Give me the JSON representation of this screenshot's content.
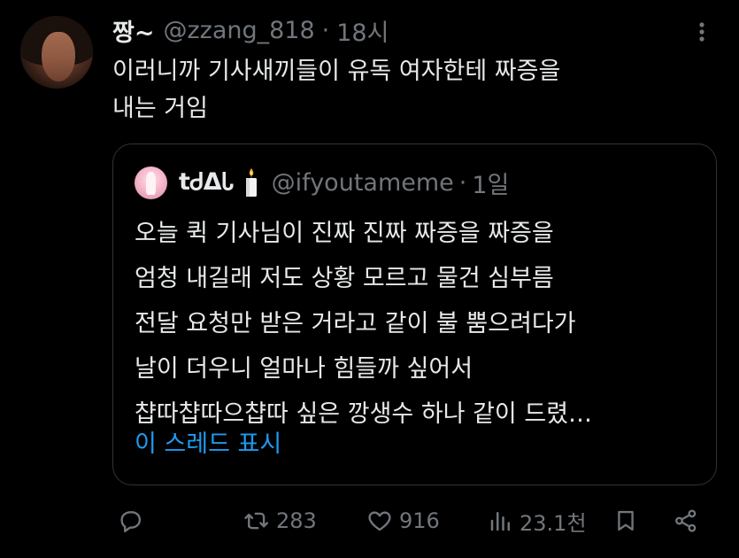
{
  "tweet": {
    "display_name": "짱~",
    "handle": "@zzang_818",
    "separator": "·",
    "time": "18시",
    "text": "이러니까 기사새끼들이 유독 여자한테 짜증을\n내는 거임"
  },
  "quoted_tweet": {
    "display_name": "tᏧᐃᏓ",
    "handle": "@ifyoutameme",
    "separator": "·",
    "time": "1일",
    "text": "오늘 퀵 기사님이 진짜 진짜 짜증을 짜증을\n엄청 내길래 저도 상황 모르고 물건 심부름\n전달 요청만 받은 거라고 같이 불 뿜으려다가\n날이 더우니 얼마나 힘들까 싶어서\n챱따챱따으챱따 싶은 깡생수 하나 같이 드렸…",
    "show_thread_label": "이 스레드 표시"
  },
  "actions": {
    "reply_icon": "reply-icon",
    "retweet_icon": "retweet-icon",
    "retweet_count": "283",
    "like_icon": "heart-icon",
    "like_count": "916",
    "views_icon": "views-icon",
    "views_count": "23.1천",
    "bookmark_icon": "bookmark-icon",
    "share_icon": "share-icon"
  },
  "colors": {
    "background": "#000000",
    "text": "#e7e9ea",
    "secondary": "#71767b",
    "link": "#1d9bf0",
    "border": "#2f3336"
  }
}
